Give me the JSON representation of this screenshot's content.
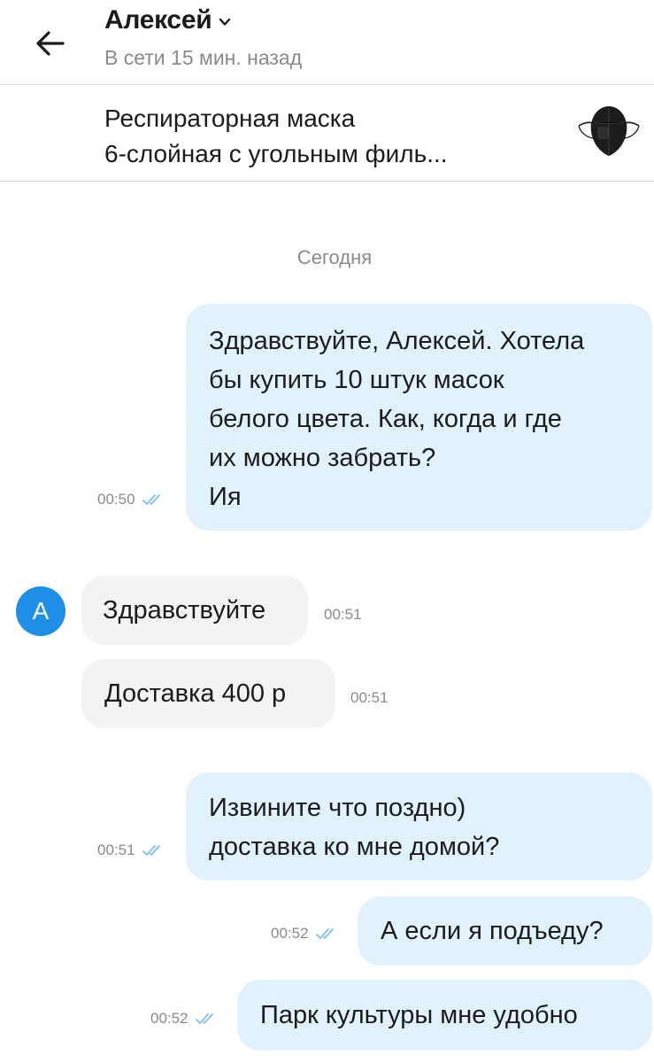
{
  "header": {
    "contact_name": "Алексей",
    "status": "В сети 15 мин. назад"
  },
  "product": {
    "title_line1": "Респираторная маска",
    "title_line2": "6-слойная с угольным филь..."
  },
  "chat": {
    "date_separator": "Сегодня",
    "avatar_letter": "А",
    "messages": [
      {
        "direction": "out",
        "lines": [
          "Здравствуйте, Алексей. Хотела",
          "бы купить 10 штук масок",
          "белого цвета.  Как, когда и где",
          "их можно забрать?",
          "Ия"
        ],
        "time": "00:50",
        "read": true
      },
      {
        "direction": "in",
        "lines": [
          "Здравствуйте"
        ],
        "time": "00:51"
      },
      {
        "direction": "in",
        "lines": [
          "Доставка 400 р"
        ],
        "time": "00:51"
      },
      {
        "direction": "out",
        "lines": [
          "Извините что поздно)",
          "доставка ко мне домой?"
        ],
        "time": "00:51",
        "read": true
      },
      {
        "direction": "out",
        "lines": [
          "А если я подъеду?"
        ],
        "time": "00:52",
        "read": true
      },
      {
        "direction": "out",
        "lines": [
          "Парк культуры мне удобно"
        ],
        "time": "00:52",
        "read": true
      }
    ]
  },
  "colors": {
    "outgoing_bubble": "#e2f2fd",
    "incoming_bubble": "#f3f3f3",
    "avatar": "#1f8ee6",
    "read_tick": "#7cc2ee",
    "secondary_text": "#8a8a8a"
  },
  "icons": {
    "back": "arrow-left-icon",
    "dropdown": "chevron-down-icon",
    "read_status": "double-check-icon"
  }
}
